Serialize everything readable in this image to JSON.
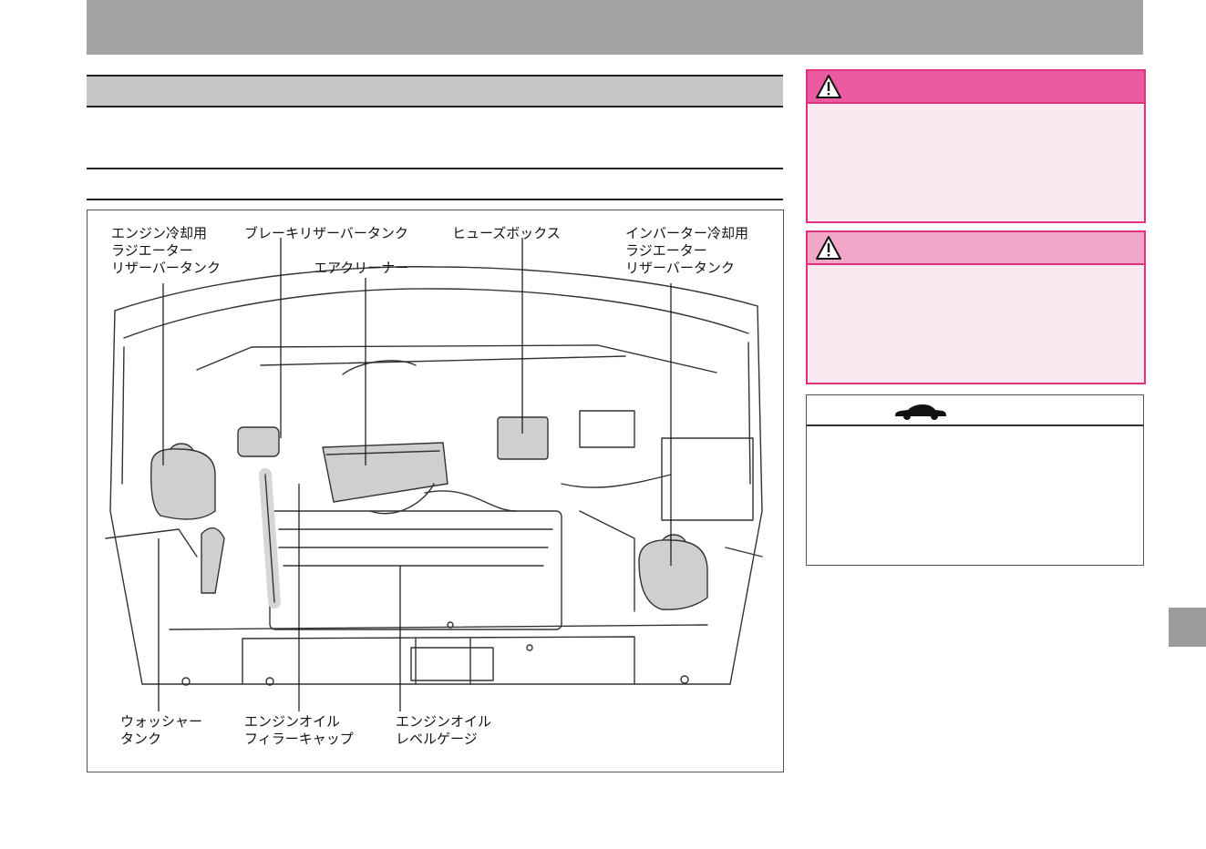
{
  "figure": {
    "labels": {
      "engine_coolant_reservoir": [
        "エンジン冷却用",
        "ラジエーター",
        "リザーバータンク"
      ],
      "brake_reservoir": [
        "ブレーキリザーバータンク"
      ],
      "fuse_box": [
        "ヒューズボックス"
      ],
      "inverter_coolant_reservoir": [
        "インバーター冷却用",
        "ラジエーター",
        "リザーバータンク"
      ],
      "air_cleaner": [
        "エアクリーナー"
      ],
      "washer_tank": [
        "ウォッシャー",
        "タンク"
      ],
      "oil_filler_cap": [
        "エンジンオイル",
        "フィラーキャップ"
      ],
      "oil_level_gauge": [
        "エンジンオイル",
        "レベルゲージ"
      ]
    }
  },
  "icons": {
    "warning_1": "warning-triangle-icon",
    "warning_2": "warning-triangle-icon",
    "info": "car-icon"
  },
  "colors": {
    "banner": "#a3a4a6",
    "section_bar": "#c5c6c7",
    "warning_border": "#e0307e",
    "warning_head_strong": "#ea5aa0",
    "warning_head_light": "#f2a6c8",
    "warning_body": "#fbe9f1",
    "page_tab": "#9a9b9d"
  }
}
